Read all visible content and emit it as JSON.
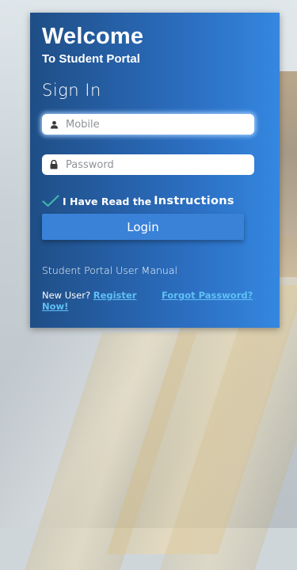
{
  "header": {
    "title": "Welcome",
    "subtitle": "To Student Portal",
    "section": "Sign In"
  },
  "form": {
    "mobile": {
      "placeholder": "Mobile",
      "value": "",
      "icon": "person-icon"
    },
    "password": {
      "placeholder": "Password",
      "value": "",
      "icon": "lock-icon"
    },
    "instructions": {
      "checked": true,
      "prefix": "I Have Read the",
      "link": "Instructions"
    },
    "login_label": "Login"
  },
  "footer": {
    "manual": "Student Portal User Manual",
    "new_user_prefix": "New User?",
    "register": "Register Now!",
    "forgot": "Forgot Password?"
  },
  "colors": {
    "card_start": "#1f4e86",
    "card_end": "#3487e0",
    "button": "#3a82d8",
    "link": "#5fc0f5",
    "check": "#3fb6a8"
  }
}
